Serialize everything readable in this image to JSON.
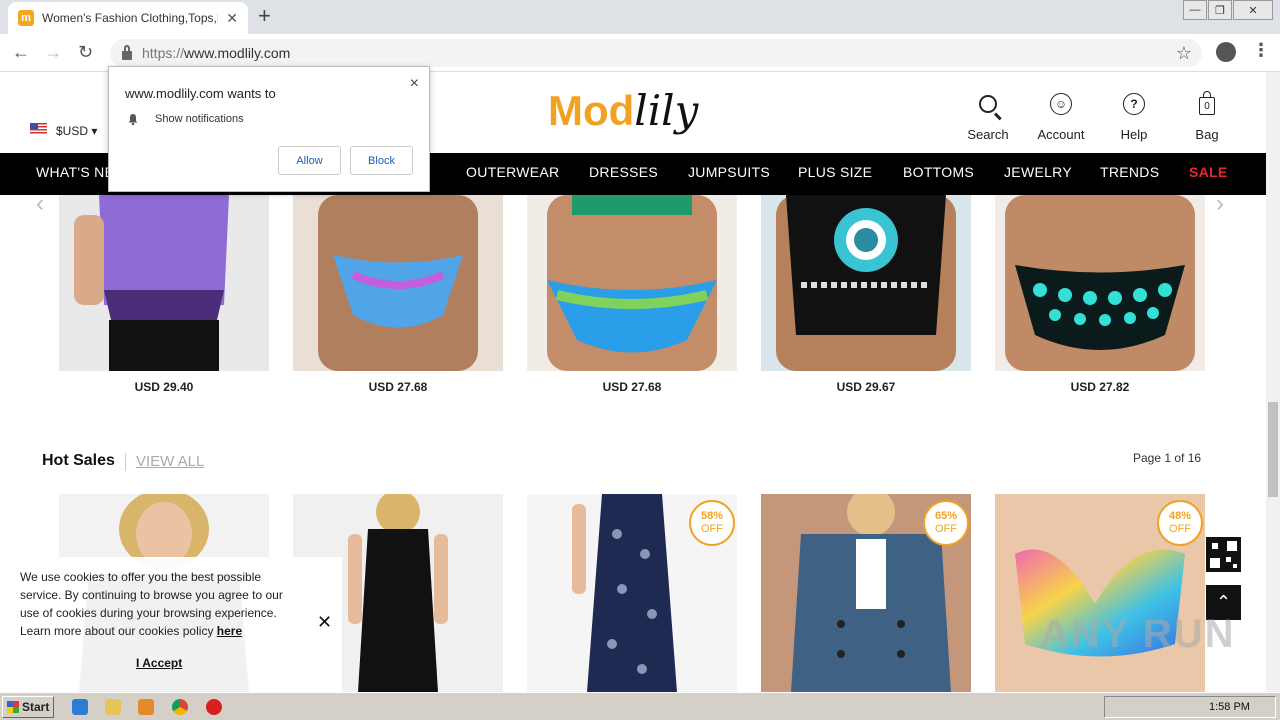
{
  "browser": {
    "tab_title": "Women's Fashion Clothing,Tops,Dre",
    "tab_favicon": "m",
    "url_prefix": "https://",
    "url_host": "www.modlily.com",
    "window_controls": [
      "—",
      "❐",
      "✕"
    ]
  },
  "site": {
    "currency": "$USD",
    "logo_mod": "Mod",
    "logo_lily": "lily",
    "header_actions": [
      {
        "label": "Search",
        "icon": "search-icon"
      },
      {
        "label": "Account",
        "icon": "account-icon"
      },
      {
        "label": "Help",
        "icon": "help-icon",
        "glyph": "?"
      },
      {
        "label": "Bag",
        "icon": "bag-icon",
        "count": "0"
      }
    ],
    "nav": [
      {
        "label": "WHAT'S NEW"
      },
      {
        "label": "OUTERWEAR"
      },
      {
        "label": "DRESSES"
      },
      {
        "label": "JUMPSUITS"
      },
      {
        "label": "PLUS SIZE"
      },
      {
        "label": "BOTTOMS"
      },
      {
        "label": "JEWELRY"
      },
      {
        "label": "TRENDS"
      },
      {
        "label": "SALE"
      }
    ],
    "row1_products": [
      {
        "price": "USD 29.40"
      },
      {
        "price": "USD 27.68"
      },
      {
        "price": "USD 27.68"
      },
      {
        "price": "USD 29.67"
      },
      {
        "price": "USD 27.82"
      }
    ],
    "hot_sales": {
      "title": "Hot Sales",
      "view_all": "VIEW ALL",
      "page_indicator": "Page 1 of 16",
      "products": [
        {
          "badge_pct": "",
          "badge_off": ""
        },
        {
          "badge_pct": "",
          "badge_off": ""
        },
        {
          "badge_pct": "58%",
          "badge_off": "OFF"
        },
        {
          "badge_pct": "65%",
          "badge_off": "OFF"
        },
        {
          "badge_pct": "48%",
          "badge_off": "OFF"
        }
      ]
    }
  },
  "notification_prompt": {
    "title": "www.modlily.com wants to",
    "permission": "Show notifications",
    "allow_label": "Allow",
    "block_label": "Block",
    "close_label": "×"
  },
  "cookie_banner": {
    "text": "We use cookies to offer you the best possible service. By continuing to browse you agree to our use of cookies during your browsing experience. Learn more about our cookies policy ",
    "link": "here",
    "accept_label": "I Accept",
    "close_label": "✕"
  },
  "watermark": "ANY RUN",
  "taskbar": {
    "start_label": "Start",
    "clock": "1:58 PM"
  },
  "colors": {
    "brand_orange": "#f0a323",
    "nav_bg": "#000000",
    "sale_red": "#e8262e"
  }
}
